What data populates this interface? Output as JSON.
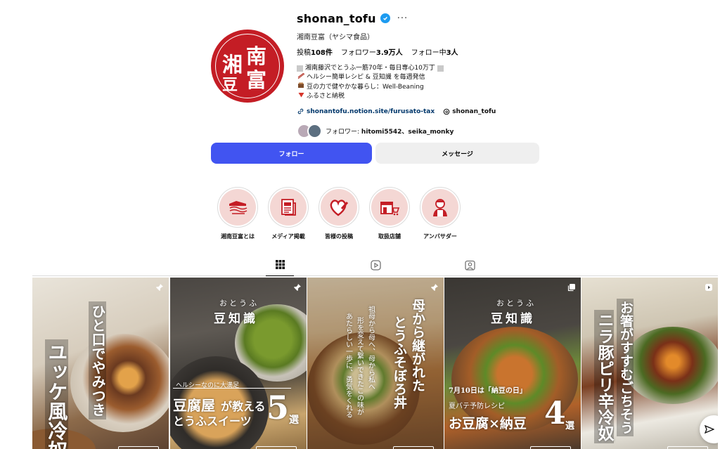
{
  "profile": {
    "username": "shonan_tofu",
    "full_name": "湘南豆富（ヤシマ食品）",
    "avatar_text": "湘南豆富",
    "stats": {
      "posts_label": "投稿",
      "posts_value": "108件",
      "followers_label": "フォロワー",
      "followers_value": "3.9万人",
      "following_label": "フォロー中",
      "following_value": "3人"
    },
    "bio": {
      "line1": "湘南藤沢でとうふ一筋70年・毎日専心10万丁",
      "line2": "ヘルシー簡単レシピ & 豆知識 を毎週発信",
      "line3": "豆の力で健やかな暮らし：Well-Beaning",
      "line4": "ふるさと納税",
      "icon2": "chopsticks-icon",
      "icon3": "tofu-icon",
      "icon4": "red-triangle-icon"
    },
    "link_url": "shonantofu.notion.site/furusato-tax",
    "threads_handle": "shonan_tofu",
    "followed_by_prefix": "フォロワー: ",
    "followed_by_names": "hitomi5542、seika_monky"
  },
  "actions": {
    "follow": "フォロー",
    "message": "メッセージ"
  },
  "highlights": [
    {
      "label": "湘南豆富とは",
      "icon": "factory-icon"
    },
    {
      "label": "メディア掲載",
      "icon": "newspaper-icon"
    },
    {
      "label": "皆様の投稿",
      "icon": "heart-pen-icon"
    },
    {
      "label": "取扱店舗",
      "icon": "store-cart-icon"
    },
    {
      "label": "アンバサダー",
      "icon": "person-icon"
    }
  ],
  "tabs": [
    "posts-grid-icon",
    "reels-icon",
    "tagged-icon"
  ],
  "posts": [
    {
      "title1": "ひと口でやみつき",
      "title2": "ユッケ風冷奴",
      "badge": "pin-icon"
    },
    {
      "kicker": "おとうふ",
      "series": "豆知識",
      "sub": "ヘルシーなのに大満足",
      "title1": "豆腐屋",
      "title_mid": "が教える",
      "title2": "とうふスイーツ",
      "number": "5",
      "unit": "選",
      "badge": "pin-icon"
    },
    {
      "title1": "母から継がれた",
      "title2": "とうふそぼろ丼",
      "note1": "祖母から母へ、母から私へ",
      "note2": "形を変えて繋いできたこの味が",
      "note3": "あたらしい一歩に、勇気をくれる",
      "badge": "pin-icon"
    },
    {
      "kicker": "おとうふ",
      "series": "豆知識",
      "date_line": "7月10日は「納豆の日」",
      "sub": "夏バテ予防レシピ",
      "title": "お豆腐×納豆",
      "number": "4",
      "unit": "選",
      "badge": "carousel-icon"
    },
    {
      "title1": "お箸がすすむごちそう",
      "title2": "ニラ豚ピリ辛冷奴",
      "badge": "reel-icon"
    }
  ],
  "colors": {
    "accent": "#4154f1",
    "brand_red": "#c41d25",
    "verified": "#1d9bf0",
    "highlight_bg": "#f4d7d4"
  }
}
